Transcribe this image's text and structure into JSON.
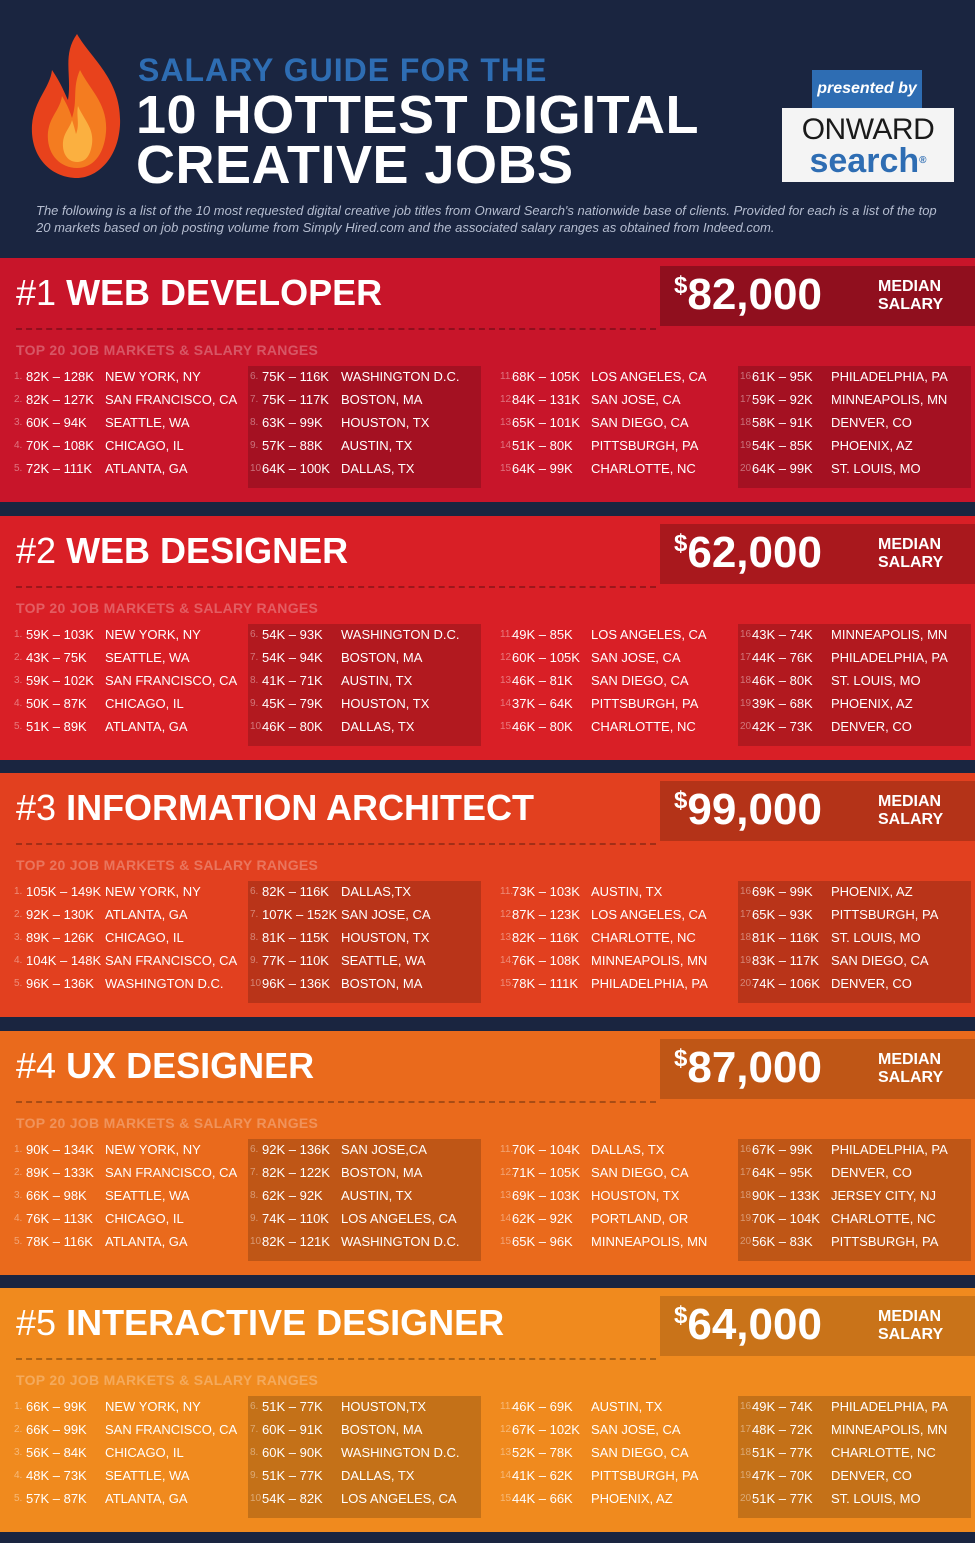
{
  "header": {
    "subtitle": "SALARY GUIDE FOR THE",
    "title_line1": "10 HOTTEST DIGITAL",
    "title_line2": "CREATIVE JOBS",
    "presented_by": "presented by",
    "logo_word1": "ONWARD",
    "logo_word2": "search",
    "logo_mark": "®",
    "intro": "The following is a list of the 10 most requested digital creative job titles from Onward Search's nationwide base of clients. Provided for each is a list of the top 20 markets based on job posting volume from Simply Hired.com and the associated salary ranges as obtained from Indeed.com."
  },
  "colors": {
    "background": "#1a2540",
    "accent_blue": "#2e6db3",
    "section_1": "#c8152a",
    "section_2": "#d91f26",
    "section_3": "#e2401f",
    "section_4": "#ea6a1c",
    "section_5": "#f08a1e"
  },
  "sections": [
    {
      "rank": "#1",
      "title": "WEB DEVELOPER",
      "currency": "$",
      "salary": "82,000",
      "salary_label_1": "MEDIAN",
      "salary_label_2": "SALARY",
      "markets_header": "TOP 20 JOB MARKETS & SALARY RANGES",
      "markets": [
        {
          "n": "1.",
          "range": "82K – 128K",
          "city": "NEW YORK, NY"
        },
        {
          "n": "2.",
          "range": "82K – 127K",
          "city": "SAN FRANCISCO, CA"
        },
        {
          "n": "3.",
          "range": "60K – 94K",
          "city": "SEATTLE, WA"
        },
        {
          "n": "4.",
          "range": "70K – 108K",
          "city": "CHICAGO, IL"
        },
        {
          "n": "5.",
          "range": "72K – 111K",
          "city": "ATLANTA, GA"
        },
        {
          "n": "6.",
          "range": "75K – 116K",
          "city": "WASHINGTON D.C."
        },
        {
          "n": "7.",
          "range": "75K – 117K",
          "city": "BOSTON, MA"
        },
        {
          "n": "8.",
          "range": "63K – 99K",
          "city": "HOUSTON, TX"
        },
        {
          "n": "9.",
          "range": "57K – 88K",
          "city": "AUSTIN, TX"
        },
        {
          "n": "10.",
          "range": "64K – 100K",
          "city": "DALLAS, TX"
        },
        {
          "n": "11.",
          "range": "68K – 105K",
          "city": "LOS ANGELES, CA"
        },
        {
          "n": "12.",
          "range": "84K – 131K",
          "city": "SAN JOSE, CA"
        },
        {
          "n": "13.",
          "range": "65K – 101K",
          "city": "SAN DIEGO, CA"
        },
        {
          "n": "14.",
          "range": "51K – 80K",
          "city": "PITTSBURGH, PA"
        },
        {
          "n": "15.",
          "range": "64K – 99K",
          "city": "CHARLOTTE, NC"
        },
        {
          "n": "16.",
          "range": "61K – 95K",
          "city": "PHILADELPHIA, PA"
        },
        {
          "n": "17.",
          "range": "59K – 92K",
          "city": "MINNEAPOLIS, MN"
        },
        {
          "n": "18.",
          "range": "58K – 91K",
          "city": "DENVER, CO"
        },
        {
          "n": "19.",
          "range": "54K – 85K",
          "city": "PHOENIX, AZ"
        },
        {
          "n": "20.",
          "range": "64K – 99K",
          "city": "ST. LOUIS, MO"
        }
      ]
    },
    {
      "rank": "#2",
      "title": "WEB DESIGNER",
      "currency": "$",
      "salary": "62,000",
      "salary_label_1": "MEDIAN",
      "salary_label_2": "SALARY",
      "markets_header": "TOP 20 JOB MARKETS & SALARY RANGES",
      "markets": [
        {
          "n": "1.",
          "range": "59K – 103K",
          "city": "NEW YORK, NY"
        },
        {
          "n": "2.",
          "range": "43K – 75K",
          "city": "SEATTLE, WA"
        },
        {
          "n": "3.",
          "range": "59K – 102K",
          "city": "SAN FRANCISCO, CA"
        },
        {
          "n": "4.",
          "range": "50K – 87K",
          "city": "CHICAGO, IL"
        },
        {
          "n": "5.",
          "range": "51K – 89K",
          "city": "ATLANTA, GA"
        },
        {
          "n": "6.",
          "range": "54K – 93K",
          "city": "WASHINGTON D.C."
        },
        {
          "n": "7.",
          "range": "54K – 94K",
          "city": "BOSTON, MA"
        },
        {
          "n": "8.",
          "range": "41K – 71K",
          "city": "AUSTIN, TX"
        },
        {
          "n": "9.",
          "range": "45K – 79K",
          "city": "HOUSTON, TX"
        },
        {
          "n": "10.",
          "range": "46K – 80K",
          "city": "DALLAS, TX"
        },
        {
          "n": "11.",
          "range": "49K – 85K",
          "city": "LOS ANGELES, CA"
        },
        {
          "n": "12.",
          "range": "60K – 105K",
          "city": "SAN JOSE, CA"
        },
        {
          "n": "13.",
          "range": "46K – 81K",
          "city": "SAN DIEGO, CA"
        },
        {
          "n": "14.",
          "range": "37K – 64K",
          "city": "PITTSBURGH, PA"
        },
        {
          "n": "15.",
          "range": "46K – 80K",
          "city": "CHARLOTTE, NC"
        },
        {
          "n": "16.",
          "range": "43K – 74K",
          "city": "MINNEAPOLIS, MN"
        },
        {
          "n": "17.",
          "range": "44K – 76K",
          "city": "PHILADELPHIA, PA"
        },
        {
          "n": "18.",
          "range": "46K – 80K",
          "city": "ST. LOUIS, MO"
        },
        {
          "n": "19.",
          "range": "39K – 68K",
          "city": "PHOENIX, AZ"
        },
        {
          "n": "20.",
          "range": "42K – 73K",
          "city": "DENVER, CO"
        }
      ]
    },
    {
      "rank": "#3",
      "title": "INFORMATION ARCHITECT",
      "currency": "$",
      "salary": "99,000",
      "salary_label_1": "MEDIAN",
      "salary_label_2": "SALARY",
      "markets_header": "TOP 20 JOB MARKETS & SALARY RANGES",
      "markets": [
        {
          "n": "1.",
          "range": "105K – 149K",
          "city": "NEW YORK, NY"
        },
        {
          "n": "2.",
          "range": "92K – 130K",
          "city": "ATLANTA, GA"
        },
        {
          "n": "3.",
          "range": "89K – 126K",
          "city": "CHICAGO, IL"
        },
        {
          "n": "4.",
          "range": "104K – 148K",
          "city": "SAN FRANCISCO, CA"
        },
        {
          "n": "5.",
          "range": "96K – 136K",
          "city": "WASHINGTON D.C."
        },
        {
          "n": "6.",
          "range": "82K – 116K",
          "city": "DALLAS,TX"
        },
        {
          "n": "7.",
          "range": "107K – 152K",
          "city": "SAN JOSE, CA"
        },
        {
          "n": "8.",
          "range": "81K – 115K",
          "city": "HOUSTON, TX"
        },
        {
          "n": "9.",
          "range": "77K – 110K",
          "city": "SEATTLE, WA"
        },
        {
          "n": "10.",
          "range": "96K – 136K",
          "city": "BOSTON, MA"
        },
        {
          "n": "11.",
          "range": "73K – 103K",
          "city": "AUSTIN, TX"
        },
        {
          "n": "12.",
          "range": "87K – 123K",
          "city": "LOS ANGELES, CA"
        },
        {
          "n": "13.",
          "range": "82K – 116K",
          "city": "CHARLOTTE, NC"
        },
        {
          "n": "14.",
          "range": "76K – 108K",
          "city": "MINNEAPOLIS, MN"
        },
        {
          "n": "15.",
          "range": "78K – 111K",
          "city": "PHILADELPHIA, PA"
        },
        {
          "n": "16.",
          "range": "69K – 99K",
          "city": "PHOENIX, AZ"
        },
        {
          "n": "17.",
          "range": "65K – 93K",
          "city": "PITTSBURGH, PA"
        },
        {
          "n": "18.",
          "range": "81K – 116K",
          "city": "ST. LOUIS, MO"
        },
        {
          "n": "19.",
          "range": "83K – 117K",
          "city": "SAN DIEGO, CA"
        },
        {
          "n": "20.",
          "range": "74K – 106K",
          "city": "DENVER, CO"
        }
      ]
    },
    {
      "rank": "#4",
      "title": "UX DESIGNER",
      "currency": "$",
      "salary": "87,000",
      "salary_label_1": "MEDIAN",
      "salary_label_2": "SALARY",
      "markets_header": "TOP 20 JOB MARKETS & SALARY RANGES",
      "markets": [
        {
          "n": "1.",
          "range": "90K – 134K",
          "city": "NEW YORK, NY"
        },
        {
          "n": "2.",
          "range": "89K – 133K",
          "city": "SAN FRANCISCO, CA"
        },
        {
          "n": "3.",
          "range": "66K – 98K",
          "city": "SEATTLE, WA"
        },
        {
          "n": "4.",
          "range": "76K – 113K",
          "city": "CHICAGO, IL"
        },
        {
          "n": "5.",
          "range": "78K – 116K",
          "city": "ATLANTA, GA"
        },
        {
          "n": "6.",
          "range": "92K – 136K",
          "city": "SAN JOSE,CA"
        },
        {
          "n": "7.",
          "range": "82K – 122K",
          "city": "BOSTON, MA"
        },
        {
          "n": "8.",
          "range": "62K – 92K",
          "city": "AUSTIN, TX"
        },
        {
          "n": "9.",
          "range": "74K – 110K",
          "city": "LOS ANGELES, CA"
        },
        {
          "n": "10.",
          "range": "82K – 121K",
          "city": "WASHINGTON D.C."
        },
        {
          "n": "11.",
          "range": "70K – 104K",
          "city": "DALLAS, TX"
        },
        {
          "n": "12.",
          "range": "71K – 105K",
          "city": "SAN DIEGO, CA"
        },
        {
          "n": "13.",
          "range": "69K – 103K",
          "city": "HOUSTON, TX"
        },
        {
          "n": "14.",
          "range": "62K – 92K",
          "city": "PORTLAND, OR"
        },
        {
          "n": "15.",
          "range": "65K – 96K",
          "city": "MINNEAPOLIS, MN"
        },
        {
          "n": "16.",
          "range": "67K – 99K",
          "city": "PHILADELPHIA, PA"
        },
        {
          "n": "17.",
          "range": "64K – 95K",
          "city": "DENVER, CO"
        },
        {
          "n": "18.",
          "range": "90K – 133K",
          "city": "JERSEY CITY, NJ"
        },
        {
          "n": "19.",
          "range": "70K – 104K",
          "city": "CHARLOTTE, NC"
        },
        {
          "n": "20.",
          "range": "56K – 83K",
          "city": "PITTSBURGH, PA"
        }
      ]
    },
    {
      "rank": "#5",
      "title": "INTERACTIVE DESIGNER",
      "currency": "$",
      "salary": "64,000",
      "salary_label_1": "MEDIAN",
      "salary_label_2": "SALARY",
      "markets_header": "TOP 20 JOB MARKETS & SALARY RANGES",
      "markets": [
        {
          "n": "1.",
          "range": "66K – 99K",
          "city": "NEW YORK, NY"
        },
        {
          "n": "2.",
          "range": "66K – 99K",
          "city": "SAN FRANCISCO, CA"
        },
        {
          "n": "3.",
          "range": "56K – 84K",
          "city": "CHICAGO, IL"
        },
        {
          "n": "4.",
          "range": "48K – 73K",
          "city": "SEATTLE, WA"
        },
        {
          "n": "5.",
          "range": "57K – 87K",
          "city": "ATLANTA, GA"
        },
        {
          "n": "6.",
          "range": "51K – 77K",
          "city": "HOUSTON,TX"
        },
        {
          "n": "7.",
          "range": "60K – 91K",
          "city": "BOSTON, MA"
        },
        {
          "n": "8.",
          "range": "60K – 90K",
          "city": "WASHINGTON D.C."
        },
        {
          "n": "9.",
          "range": "51K – 77K",
          "city": "DALLAS, TX"
        },
        {
          "n": "10.",
          "range": "54K – 82K",
          "city": "LOS ANGELES, CA"
        },
        {
          "n": "11.",
          "range": "46K – 69K",
          "city": "AUSTIN, TX"
        },
        {
          "n": "12.",
          "range": "67K – 102K",
          "city": "SAN JOSE, CA"
        },
        {
          "n": "13.",
          "range": "52K – 78K",
          "city": "SAN DIEGO, CA"
        },
        {
          "n": "14.",
          "range": "41K – 62K",
          "city": "PITTSBURGH, PA"
        },
        {
          "n": "15.",
          "range": "44K – 66K",
          "city": "PHOENIX, AZ"
        },
        {
          "n": "16.",
          "range": "49K – 74K",
          "city": "PHILADELPHIA, PA"
        },
        {
          "n": "17.",
          "range": "48K – 72K",
          "city": "MINNEAPOLIS, MN"
        },
        {
          "n": "18.",
          "range": "51K – 77K",
          "city": "CHARLOTTE, NC"
        },
        {
          "n": "19.",
          "range": "47K – 70K",
          "city": "DENVER, CO"
        },
        {
          "n": "20.",
          "range": "51K – 77K",
          "city": "ST. LOUIS, MO"
        }
      ]
    }
  ]
}
